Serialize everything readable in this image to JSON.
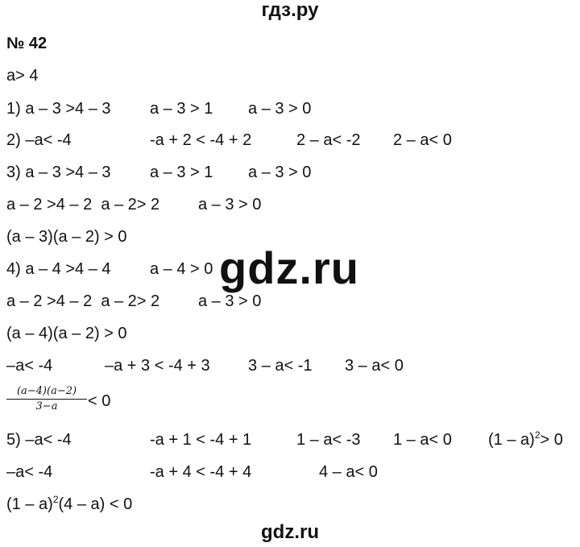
{
  "header": {
    "site": "гдз.ру"
  },
  "task_number": "№ 42",
  "lines": [
    {
      "segments": [
        "a> 4"
      ]
    },
    {
      "segments": [
        "1) a – 3 >4 – 3",
        "a – 3 > 1",
        "a – 3 > 0"
      ]
    },
    {
      "segments": [
        "2) –a< -4",
        "-a + 2 < -4 + 2",
        "2 – a< -2",
        "2 – a< 0"
      ]
    },
    {
      "segments": [
        "3) a – 3 >4 – 3",
        "a – 3 > 1",
        "a – 3 > 0"
      ]
    },
    {
      "segments": [
        "a – 2 >4 – 2  a – 2> 2",
        "a – 3 > 0"
      ]
    },
    {
      "segments": [
        "(a – 3)(a – 2) > 0"
      ]
    },
    {
      "segments": [
        "4) a – 4 >4 – 4",
        "a – 4 > 0"
      ]
    },
    {
      "segments": [
        "a – 2 >4 – 2  a – 2> 2",
        "a – 3 > 0"
      ]
    },
    {
      "segments": [
        "(a – 4)(a – 2) > 0"
      ]
    },
    {
      "segments": [
        "–a< -4",
        "–a + 3 < -4 + 3",
        "3 – a< -1",
        "3 – a< 0"
      ]
    }
  ],
  "fraction": {
    "numerator": "(a−4)(a−2)",
    "denominator": "3−a",
    "rest": "< 0"
  },
  "line5": {
    "segments": [
      "5) –a< -4",
      "-a + 1 < -4 + 1",
      "1 – a< -3",
      "1 – a< 0"
    ],
    "last_base": "(1 – a)",
    "last_exp": "2",
    "last_rest": "> 0"
  },
  "line6": {
    "segments": [
      "–a< -4",
      "-a + 4 < -4 + 4",
      "4 – a< 0"
    ]
  },
  "line7": {
    "base": "(1 – a)",
    "exp": "2",
    "rest": "(4 – a) < 0"
  },
  "watermark": "gdz.ru",
  "footer": {
    "site": "gdz.ru"
  }
}
